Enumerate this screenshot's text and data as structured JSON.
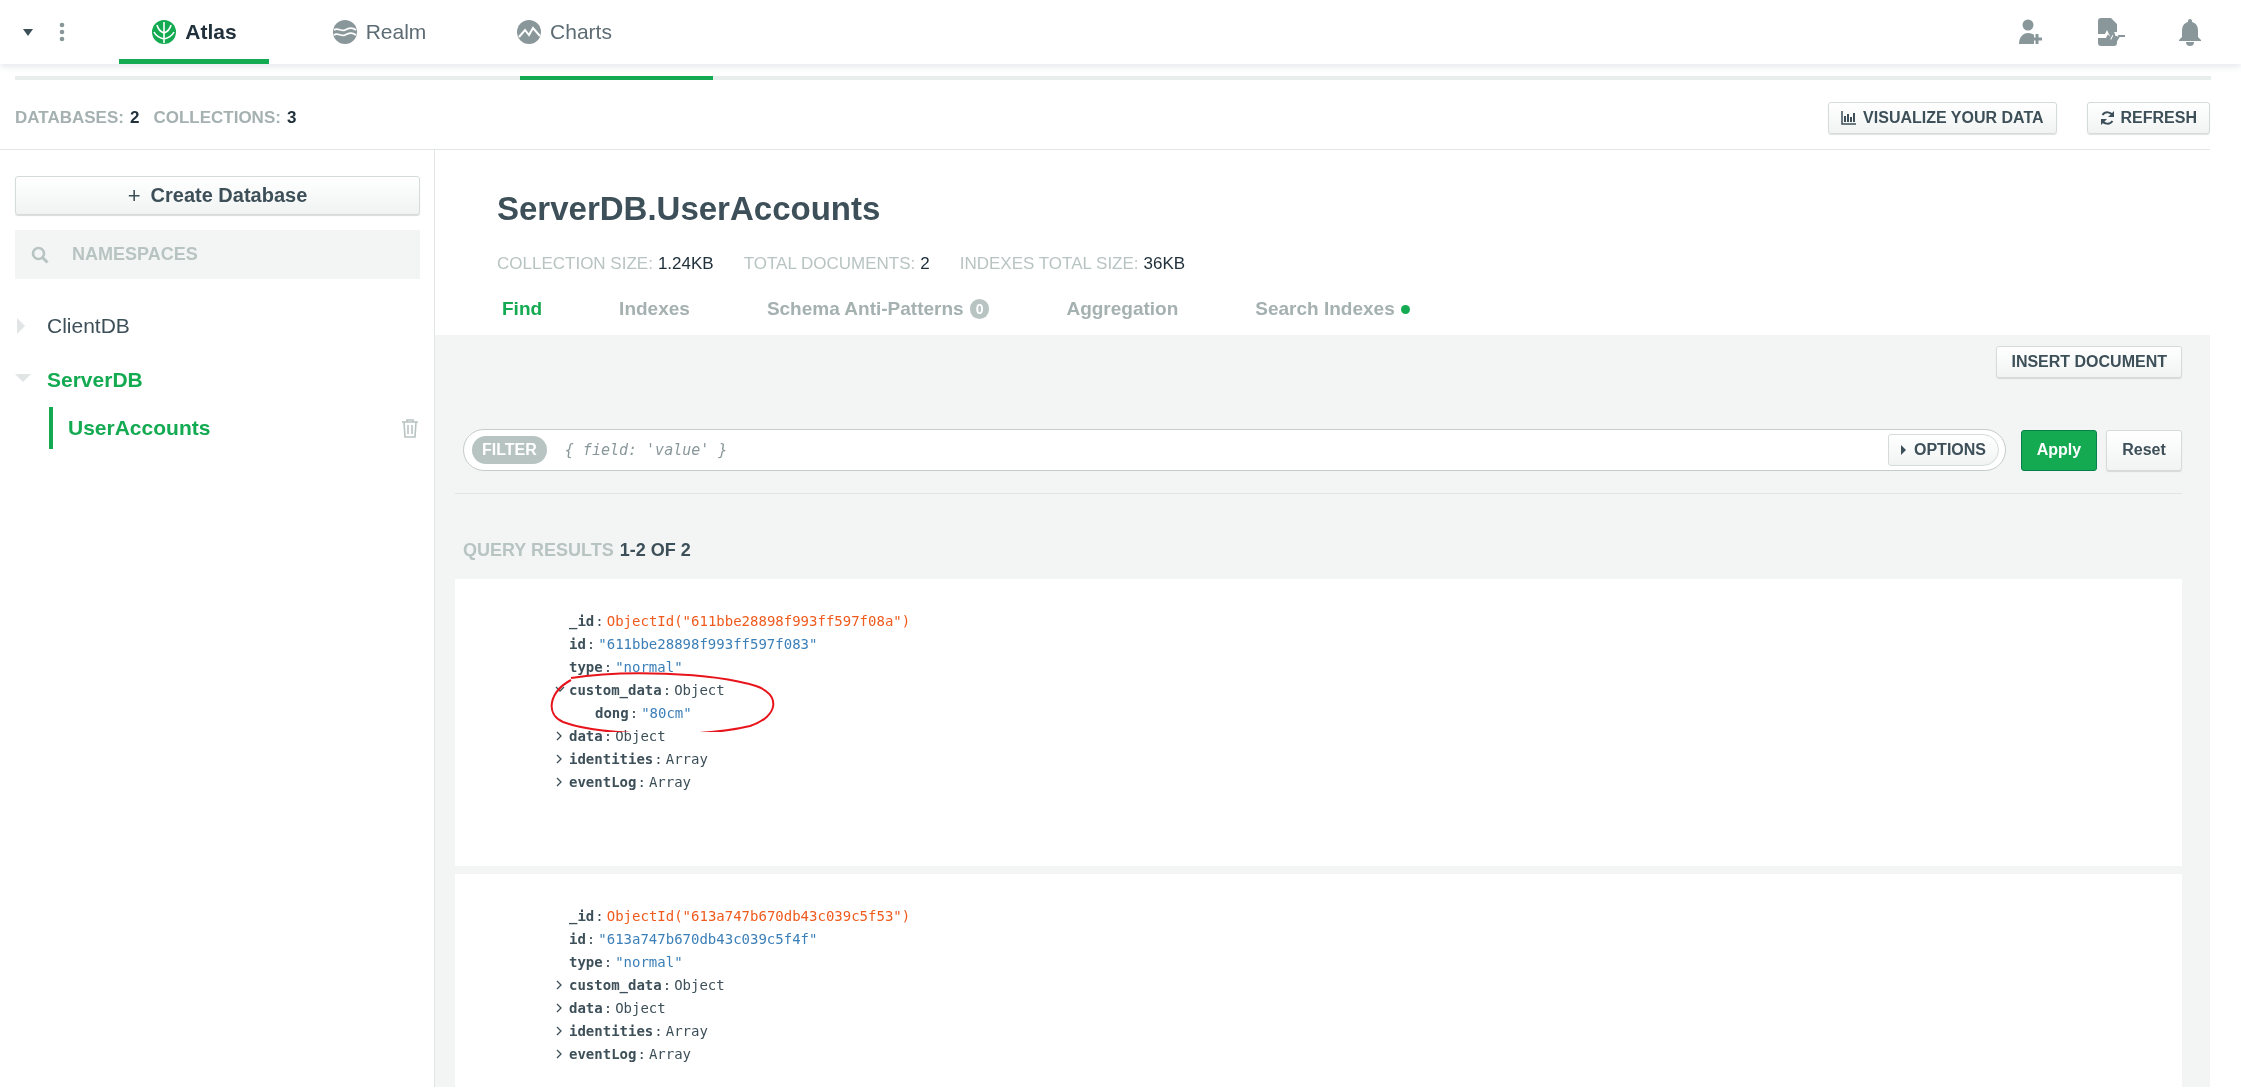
{
  "top_nav": {
    "tabs": [
      {
        "label": "Atlas",
        "selected": true,
        "kind": "atlas"
      },
      {
        "label": "Realm",
        "selected": false,
        "kind": "realm"
      },
      {
        "label": "Charts",
        "selected": false,
        "kind": "charts"
      }
    ]
  },
  "stats": [
    {
      "label": "DATABASES:",
      "value": "2"
    },
    {
      "label": "COLLECTIONS:",
      "value": "3"
    }
  ],
  "toolbar_buttons": [
    {
      "label": "VISUALIZE YOUR DATA",
      "kind": "chart"
    },
    {
      "label": "REFRESH",
      "kind": "refresh"
    }
  ],
  "sidebar": {
    "create_button": "Create Database",
    "create_icon": "+",
    "search": {
      "placeholder": "NAMESPACES"
    },
    "databases": [
      {
        "name": "ClientDB",
        "expanded": false,
        "selected": false
      },
      {
        "name": "ServerDB",
        "expanded": true,
        "selected": true,
        "children": [
          {
            "name": "UserAccounts",
            "selected": true
          }
        ]
      }
    ]
  },
  "collection": {
    "title": "ServerDB.UserAccounts",
    "stats": [
      {
        "label": "COLLECTION SIZE:",
        "value": "1.24KB"
      },
      {
        "label": "TOTAL DOCUMENTS:",
        "value": "2"
      },
      {
        "label": "INDEXES TOTAL SIZE:",
        "value": "36KB"
      }
    ],
    "tabs": [
      {
        "label": "Find",
        "selected": true
      },
      {
        "label": "Indexes",
        "selected": false
      },
      {
        "label": "Schema Anti-Patterns",
        "selected": false,
        "badge": "0"
      },
      {
        "label": "Aggregation",
        "selected": false
      },
      {
        "label": "Search Indexes",
        "selected": false,
        "dot": true
      }
    ]
  },
  "insert_button": "INSERT DOCUMENT",
  "filter": {
    "tag": "FILTER",
    "placeholder": "{ field: 'value' }",
    "options": "OPTIONS",
    "apply": "Apply",
    "reset": "Reset"
  },
  "results": {
    "label": "QUERY RESULTS",
    "range": "1-2 OF 2"
  },
  "documents": [
    {
      "fields": [
        {
          "key": "_id",
          "sep": ":",
          "value": "ObjectId(\"611bbe28898f993ff597f08a\")",
          "kind": "objectid"
        },
        {
          "key": "id",
          "sep": ":",
          "value": "\"611bbe28898f993ff597f083\"",
          "kind": "string"
        },
        {
          "key": "type",
          "sep": ":",
          "value": "\"normal\"",
          "kind": "string"
        },
        {
          "key": "custom_data",
          "sep": ":",
          "value": "Object",
          "kind": "type",
          "expanded": true,
          "annotated": true,
          "children": [
            {
              "key": "dong",
              "sep": ":",
              "value": "\"80cm\"",
              "kind": "string"
            }
          ]
        },
        {
          "key": "data",
          "sep": ":",
          "value": "Object",
          "kind": "type",
          "expanded": false
        },
        {
          "key": "identities",
          "sep": ":",
          "value": "Array",
          "kind": "type",
          "expanded": false
        },
        {
          "key": "eventLog",
          "sep": ":",
          "value": "Array",
          "kind": "type",
          "expanded": false
        }
      ]
    },
    {
      "fields": [
        {
          "key": "_id",
          "sep": ":",
          "value": "ObjectId(\"613a747b670db43c039c5f53\")",
          "kind": "objectid"
        },
        {
          "key": "id",
          "sep": ":",
          "value": "\"613a747b670db43c039c5f4f\"",
          "kind": "string"
        },
        {
          "key": "type",
          "sep": ":",
          "value": "\"normal\"",
          "kind": "string"
        },
        {
          "key": "custom_data",
          "sep": ":",
          "value": "Object",
          "kind": "type",
          "expanded": false
        },
        {
          "key": "data",
          "sep": ":",
          "value": "Object",
          "kind": "type",
          "expanded": false
        },
        {
          "key": "identities",
          "sep": ":",
          "value": "Array",
          "kind": "type",
          "expanded": false
        },
        {
          "key": "eventLog",
          "sep": ":",
          "value": "Array",
          "kind": "type",
          "expanded": false
        }
      ]
    }
  ]
}
